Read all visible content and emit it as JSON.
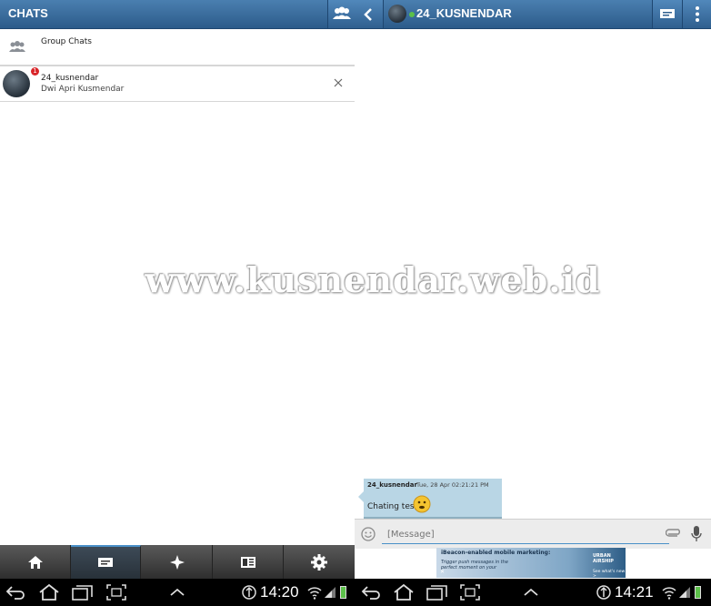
{
  "left": {
    "title": "CHATS",
    "group_chats_label": "Group Chats",
    "chat": {
      "name": "24_kusnendar",
      "subtitle": "Dwi Apri Kusmendar",
      "badge": "1"
    }
  },
  "right": {
    "contact_name": "24_KUSNENDAR",
    "message": {
      "sender": "24_kusnendar",
      "timestamp": "Tue, 28 Apr 02:21:21 PM",
      "text": "Chating tes"
    },
    "input_placeholder": "[Message]",
    "ad": {
      "headline": "iBeacon-enabled mobile marketing:",
      "body": "Trigger push messages in the perfect moment on your",
      "brand": "URBAN AIRSHIP",
      "cta": "See what's new >"
    }
  },
  "watermark": "www.kusnendar.web.id",
  "system": {
    "clock_left": "14:20",
    "clock_right": "14:21"
  },
  "colors": {
    "header_blue": "#2c5b8a",
    "bubble": "#b9d6e5",
    "badge_red": "#d9262a",
    "online_green": "#5cc04a"
  }
}
